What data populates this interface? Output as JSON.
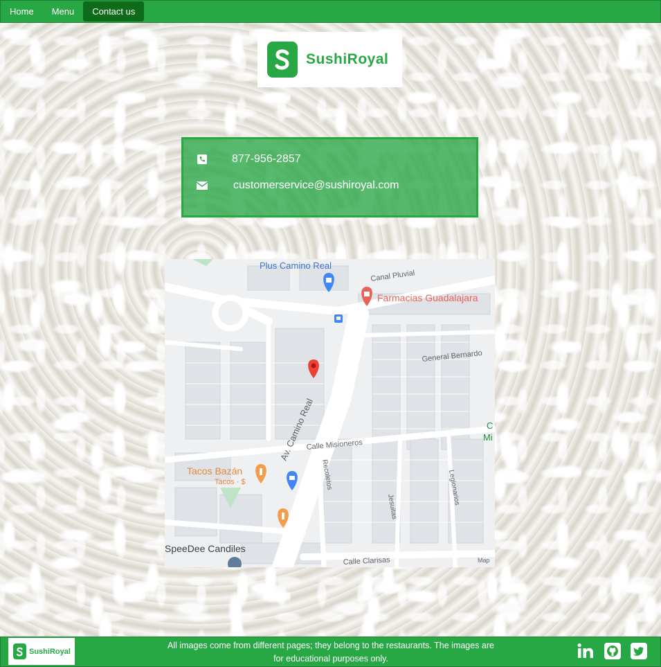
{
  "nav": {
    "items": [
      {
        "label": "Home",
        "active": false
      },
      {
        "label": "Menu",
        "active": false
      },
      {
        "label": "Contact us",
        "active": true
      }
    ]
  },
  "brand": {
    "name": "SushiRoyal",
    "logo_letter": "S",
    "accent": "#28a745"
  },
  "contact": {
    "phone": "877-956-2857",
    "email": "customerservice@sushiroyal.com",
    "phone_icon": "phone-square-icon",
    "email_icon": "envelope-icon"
  },
  "map": {
    "labels": {
      "plus": "Plus Camino Real",
      "canal": "Canal Pluvial",
      "farmacias": "Farmacias Guadalajara",
      "bernardo": "General Bernardo",
      "camino": "Av. Camino Real",
      "misioneros": "Calle Misioneros",
      "tacos": "Tacos Bazán",
      "tacos_sub": "Tacos · $",
      "recoletos": "Recoletos",
      "jesuitas": "Jesuitas",
      "legionarios": "Legionarios",
      "speedee": "SpeeDee Candiles",
      "clarisas": "Calle Clarisas",
      "map_credit": "Map",
      "edge_c": "C",
      "edge_mi": "Mi"
    }
  },
  "footer": {
    "note": "All images come from different pages; they belong to the restaurants. The images are for educational purposes only.",
    "social": [
      "linkedin-icon",
      "github-icon",
      "twitter-icon"
    ]
  }
}
